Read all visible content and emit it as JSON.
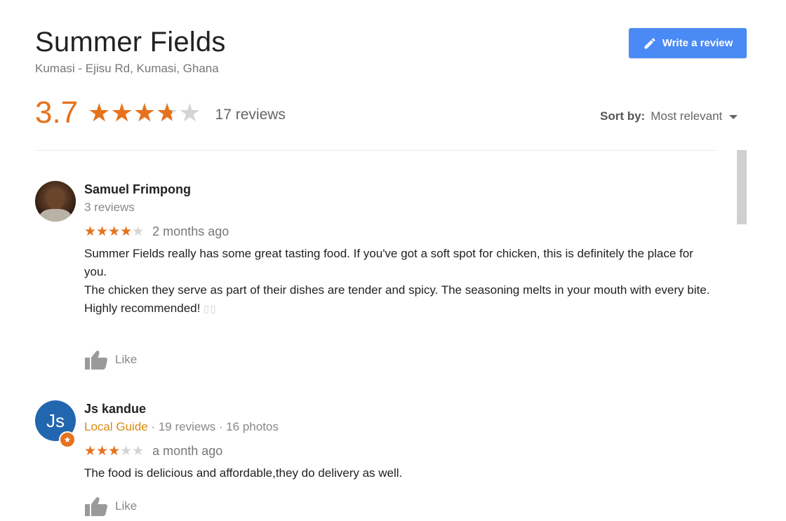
{
  "place": {
    "name": "Summer Fields",
    "address": "Kumasi - Ejisu Rd, Kumasi, Ghana",
    "rating": "3.7",
    "rating_fraction": 0.74,
    "review_count_label": "17 reviews"
  },
  "actions": {
    "write_review_label": "Write a review"
  },
  "sort": {
    "label": "Sort by:",
    "value": "Most relevant"
  },
  "colors": {
    "star_fill": "#e6721c",
    "star_empty": "#d4d4d4",
    "button_blue": "#4a8af4",
    "local_guide": "#d88a14"
  },
  "reviews": [
    {
      "name": "Samuel Frimpong",
      "meta": "3 reviews",
      "stars": 4,
      "date": "2 months ago",
      "text": [
        "Summer Fields really has some great tasting food. If you've got a soft spot for chicken, this is definitely the place for you.",
        "The chicken they serve as part of their dishes are tender and spicy. The seasoning melts in your mouth with every bite.",
        "Highly recommended!"
      ],
      "trailing_glyphs": "▯▯",
      "like_label": "Like",
      "avatar_icon": "user-photo"
    },
    {
      "name": "Js kandue",
      "avatar_initials": "Js",
      "local_guide": "Local Guide",
      "meta": " · 19 reviews · 16 photos",
      "stars": 3,
      "date": "a month ago",
      "text": [
        "The food is delicious and affordable,they do delivery as well."
      ],
      "like_label": "Like"
    }
  ]
}
